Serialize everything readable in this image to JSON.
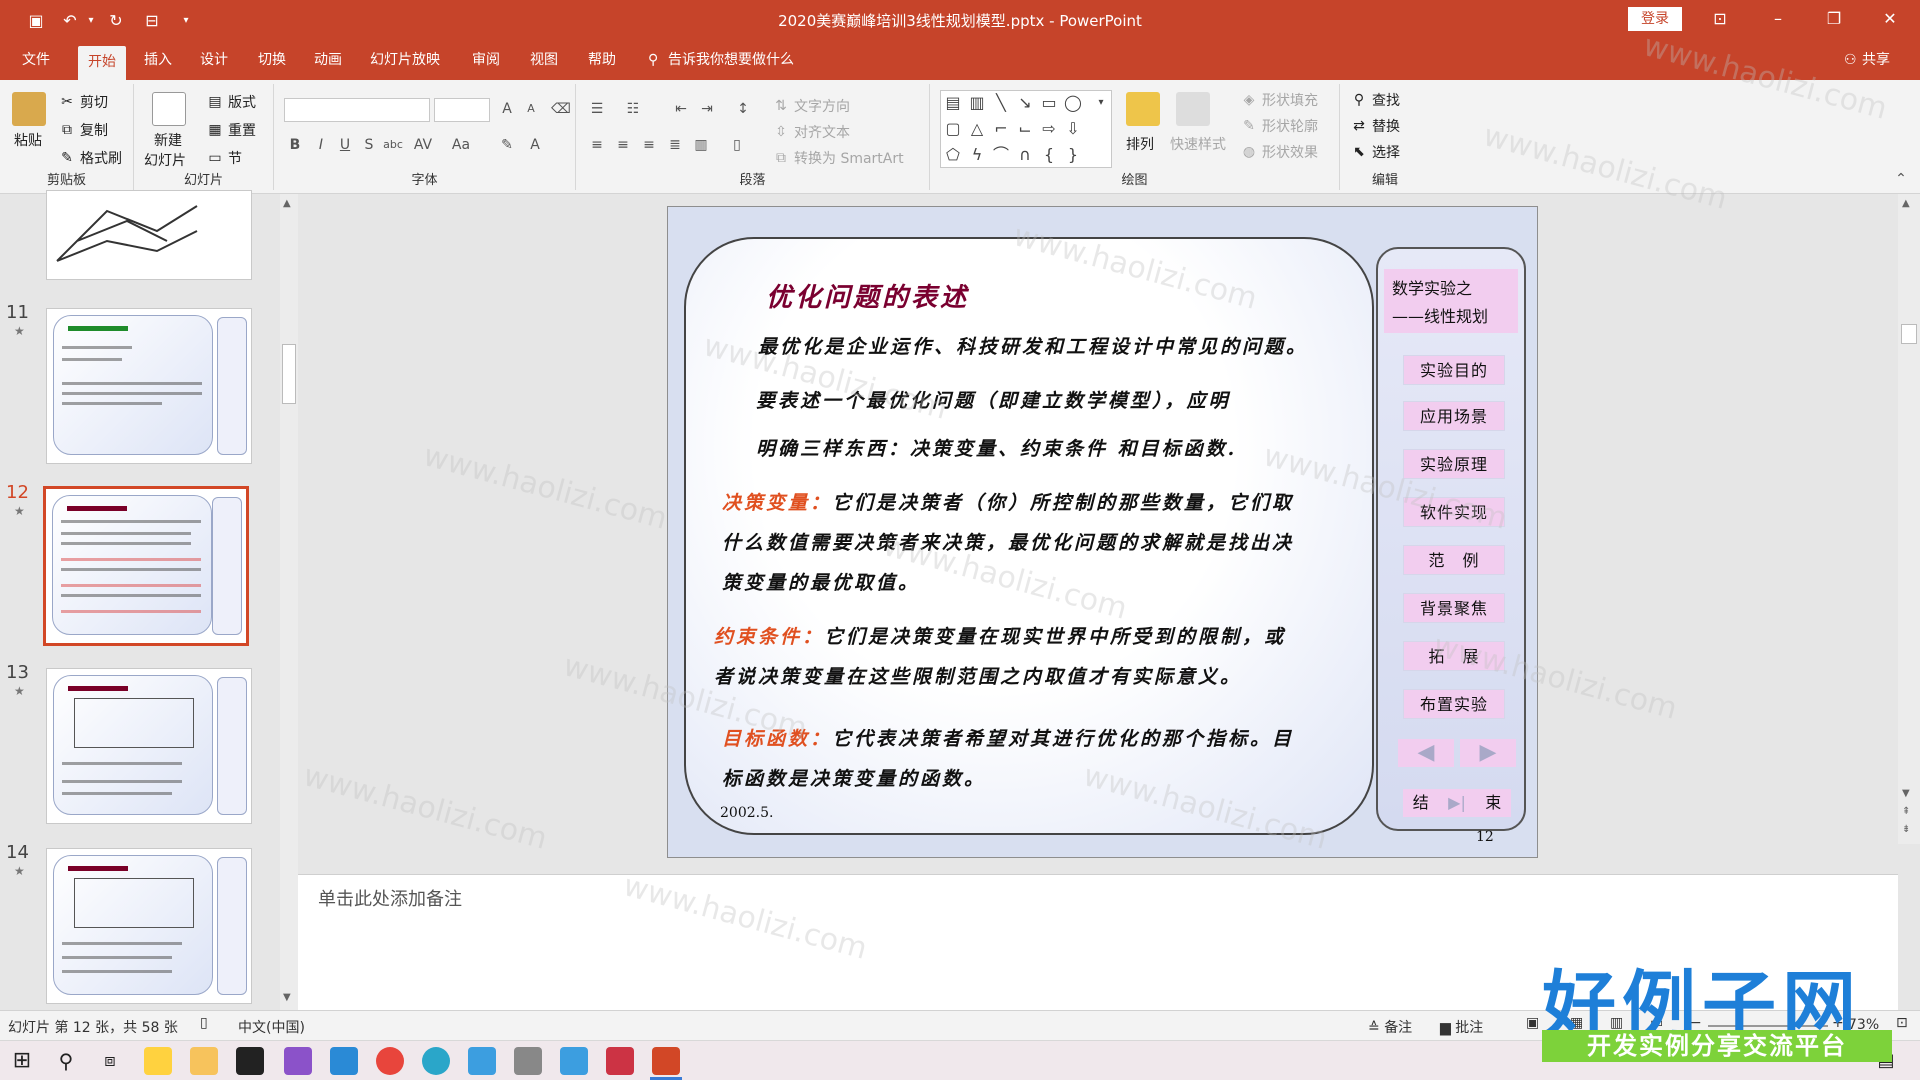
{
  "window": {
    "title": "2020美赛巅峰培训3线性规划模型.pptx  -  PowerPoint",
    "login": "登录"
  },
  "tabs": [
    "文件",
    "开始",
    "插入",
    "设计",
    "切换",
    "动画",
    "幻灯片放映",
    "审阅",
    "视图",
    "帮助"
  ],
  "tell_me": "告诉我你想要做什么",
  "share": "共享",
  "ribbon": {
    "clipboard": {
      "label": "剪贴板",
      "paste": "粘贴",
      "cut": "剪切",
      "copy": "复制",
      "format_painter": "格式刷"
    },
    "slides": {
      "label": "幻灯片",
      "new_slide_1": "新建",
      "new_slide_2": "幻灯片",
      "layout": "版式",
      "reset": "重置",
      "section": "节"
    },
    "font": {
      "label": "字体"
    },
    "paragraph": {
      "label": "段落",
      "text_direction": "文字方向",
      "align_text": "对齐文本",
      "smartart": "转换为 SmartArt"
    },
    "drawing": {
      "label": "绘图",
      "arrange": "排列",
      "quick_styles": "快速样式",
      "shape_fill": "形状填充",
      "shape_outline": "形状轮廓",
      "shape_effects": "形状效果"
    },
    "editing": {
      "label": "编辑",
      "find": "查找",
      "replace": "替换",
      "select": "选择"
    }
  },
  "thumbnails": [
    {
      "num": "11",
      "title": "最优化问题简介"
    },
    {
      "num": "12",
      "title": "优化问题的表述"
    },
    {
      "num": "13",
      "title": "生产计划问题"
    },
    {
      "num": "14",
      "title": "生产计划问题"
    }
  ],
  "slide": {
    "title": "优化问题的表述",
    "p1": "最优化是企业运作、科技研发和工程设计中常见的问题。",
    "p2a": "要表述一个最优化问题（即建立数学模型），应明",
    "p2b": "明确三样东西：决策变量、约束条件 和目标函数.",
    "dv_label": "决策变量：",
    "dv_1": "它们是决策者（你）所控制的那些数量，它们取",
    "dv_2": "什么数值需要决策者来决策，最优化问题的求解就是找出决",
    "dv_3": "策变量的最优取值。",
    "ct_label": "约束条件：",
    "ct_1": "它们是决策变量在现实世界中所受到的限制，或",
    "ct_2": "者说决策变量在这些限制范围之内取值才有实际意义。",
    "ob_label": "目标函数：",
    "ob_1": "它代表决策者希望对其进行优化的那个指标。目",
    "ob_2": "标函数是决策变量的函数。",
    "date": "2002.5.",
    "page": "12",
    "side_title_1": "数学实验之",
    "side_title_2": "——线性规划",
    "menu": [
      "实验目的",
      "应用场景",
      "实验原理",
      "软件实现",
      "范　例",
      "背景聚焦",
      "拓　展",
      "布置实验"
    ],
    "end_left": "结",
    "end_right": "束"
  },
  "notes_placeholder": "单击此处添加备注",
  "status": {
    "slide_info": "幻灯片 第 12 张，共 58 张",
    "language": "中文(中国)",
    "notes": "备注",
    "comments": "批注",
    "zoom": "73%"
  },
  "watermark": "www.haolizi.com",
  "brand": {
    "line1": "好例子网",
    "line2": "开发实例分享交流平台"
  }
}
